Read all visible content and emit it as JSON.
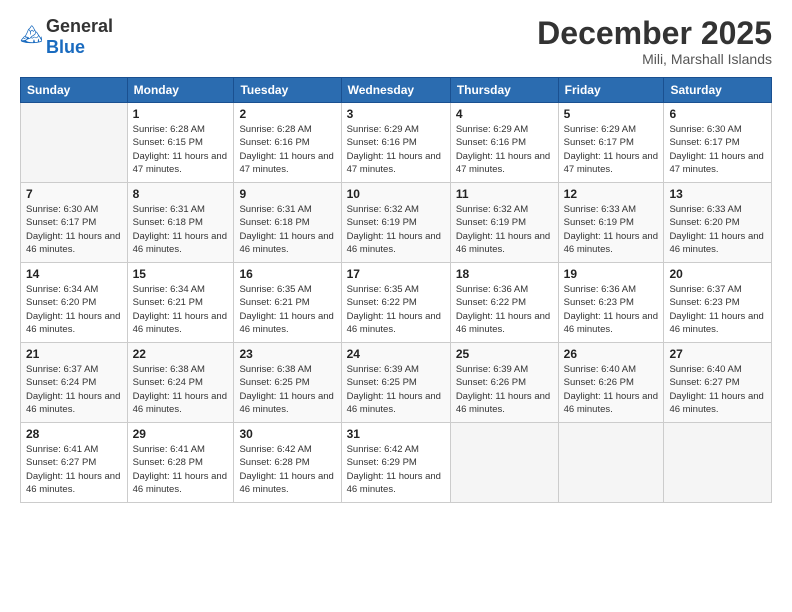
{
  "logo": {
    "general": "General",
    "blue": "Blue"
  },
  "title": "December 2025",
  "location": "Mili, Marshall Islands",
  "days_of_week": [
    "Sunday",
    "Monday",
    "Tuesday",
    "Wednesday",
    "Thursday",
    "Friday",
    "Saturday"
  ],
  "weeks": [
    [
      {
        "day": "",
        "sunrise": "",
        "sunset": "",
        "daylight": ""
      },
      {
        "day": "1",
        "sunrise": "Sunrise: 6:28 AM",
        "sunset": "Sunset: 6:15 PM",
        "daylight": "Daylight: 11 hours and 47 minutes."
      },
      {
        "day": "2",
        "sunrise": "Sunrise: 6:28 AM",
        "sunset": "Sunset: 6:16 PM",
        "daylight": "Daylight: 11 hours and 47 minutes."
      },
      {
        "day": "3",
        "sunrise": "Sunrise: 6:29 AM",
        "sunset": "Sunset: 6:16 PM",
        "daylight": "Daylight: 11 hours and 47 minutes."
      },
      {
        "day": "4",
        "sunrise": "Sunrise: 6:29 AM",
        "sunset": "Sunset: 6:16 PM",
        "daylight": "Daylight: 11 hours and 47 minutes."
      },
      {
        "day": "5",
        "sunrise": "Sunrise: 6:29 AM",
        "sunset": "Sunset: 6:17 PM",
        "daylight": "Daylight: 11 hours and 47 minutes."
      },
      {
        "day": "6",
        "sunrise": "Sunrise: 6:30 AM",
        "sunset": "Sunset: 6:17 PM",
        "daylight": "Daylight: 11 hours and 47 minutes."
      }
    ],
    [
      {
        "day": "7",
        "sunrise": "Sunrise: 6:30 AM",
        "sunset": "Sunset: 6:17 PM",
        "daylight": "Daylight: 11 hours and 46 minutes."
      },
      {
        "day": "8",
        "sunrise": "Sunrise: 6:31 AM",
        "sunset": "Sunset: 6:18 PM",
        "daylight": "Daylight: 11 hours and 46 minutes."
      },
      {
        "day": "9",
        "sunrise": "Sunrise: 6:31 AM",
        "sunset": "Sunset: 6:18 PM",
        "daylight": "Daylight: 11 hours and 46 minutes."
      },
      {
        "day": "10",
        "sunrise": "Sunrise: 6:32 AM",
        "sunset": "Sunset: 6:19 PM",
        "daylight": "Daylight: 11 hours and 46 minutes."
      },
      {
        "day": "11",
        "sunrise": "Sunrise: 6:32 AM",
        "sunset": "Sunset: 6:19 PM",
        "daylight": "Daylight: 11 hours and 46 minutes."
      },
      {
        "day": "12",
        "sunrise": "Sunrise: 6:33 AM",
        "sunset": "Sunset: 6:19 PM",
        "daylight": "Daylight: 11 hours and 46 minutes."
      },
      {
        "day": "13",
        "sunrise": "Sunrise: 6:33 AM",
        "sunset": "Sunset: 6:20 PM",
        "daylight": "Daylight: 11 hours and 46 minutes."
      }
    ],
    [
      {
        "day": "14",
        "sunrise": "Sunrise: 6:34 AM",
        "sunset": "Sunset: 6:20 PM",
        "daylight": "Daylight: 11 hours and 46 minutes."
      },
      {
        "day": "15",
        "sunrise": "Sunrise: 6:34 AM",
        "sunset": "Sunset: 6:21 PM",
        "daylight": "Daylight: 11 hours and 46 minutes."
      },
      {
        "day": "16",
        "sunrise": "Sunrise: 6:35 AM",
        "sunset": "Sunset: 6:21 PM",
        "daylight": "Daylight: 11 hours and 46 minutes."
      },
      {
        "day": "17",
        "sunrise": "Sunrise: 6:35 AM",
        "sunset": "Sunset: 6:22 PM",
        "daylight": "Daylight: 11 hours and 46 minutes."
      },
      {
        "day": "18",
        "sunrise": "Sunrise: 6:36 AM",
        "sunset": "Sunset: 6:22 PM",
        "daylight": "Daylight: 11 hours and 46 minutes."
      },
      {
        "day": "19",
        "sunrise": "Sunrise: 6:36 AM",
        "sunset": "Sunset: 6:23 PM",
        "daylight": "Daylight: 11 hours and 46 minutes."
      },
      {
        "day": "20",
        "sunrise": "Sunrise: 6:37 AM",
        "sunset": "Sunset: 6:23 PM",
        "daylight": "Daylight: 11 hours and 46 minutes."
      }
    ],
    [
      {
        "day": "21",
        "sunrise": "Sunrise: 6:37 AM",
        "sunset": "Sunset: 6:24 PM",
        "daylight": "Daylight: 11 hours and 46 minutes."
      },
      {
        "day": "22",
        "sunrise": "Sunrise: 6:38 AM",
        "sunset": "Sunset: 6:24 PM",
        "daylight": "Daylight: 11 hours and 46 minutes."
      },
      {
        "day": "23",
        "sunrise": "Sunrise: 6:38 AM",
        "sunset": "Sunset: 6:25 PM",
        "daylight": "Daylight: 11 hours and 46 minutes."
      },
      {
        "day": "24",
        "sunrise": "Sunrise: 6:39 AM",
        "sunset": "Sunset: 6:25 PM",
        "daylight": "Daylight: 11 hours and 46 minutes."
      },
      {
        "day": "25",
        "sunrise": "Sunrise: 6:39 AM",
        "sunset": "Sunset: 6:26 PM",
        "daylight": "Daylight: 11 hours and 46 minutes."
      },
      {
        "day": "26",
        "sunrise": "Sunrise: 6:40 AM",
        "sunset": "Sunset: 6:26 PM",
        "daylight": "Daylight: 11 hours and 46 minutes."
      },
      {
        "day": "27",
        "sunrise": "Sunrise: 6:40 AM",
        "sunset": "Sunset: 6:27 PM",
        "daylight": "Daylight: 11 hours and 46 minutes."
      }
    ],
    [
      {
        "day": "28",
        "sunrise": "Sunrise: 6:41 AM",
        "sunset": "Sunset: 6:27 PM",
        "daylight": "Daylight: 11 hours and 46 minutes."
      },
      {
        "day": "29",
        "sunrise": "Sunrise: 6:41 AM",
        "sunset": "Sunset: 6:28 PM",
        "daylight": "Daylight: 11 hours and 46 minutes."
      },
      {
        "day": "30",
        "sunrise": "Sunrise: 6:42 AM",
        "sunset": "Sunset: 6:28 PM",
        "daylight": "Daylight: 11 hours and 46 minutes."
      },
      {
        "day": "31",
        "sunrise": "Sunrise: 6:42 AM",
        "sunset": "Sunset: 6:29 PM",
        "daylight": "Daylight: 11 hours and 46 minutes."
      },
      {
        "day": "",
        "sunrise": "",
        "sunset": "",
        "daylight": ""
      },
      {
        "day": "",
        "sunrise": "",
        "sunset": "",
        "daylight": ""
      },
      {
        "day": "",
        "sunrise": "",
        "sunset": "",
        "daylight": ""
      }
    ]
  ]
}
